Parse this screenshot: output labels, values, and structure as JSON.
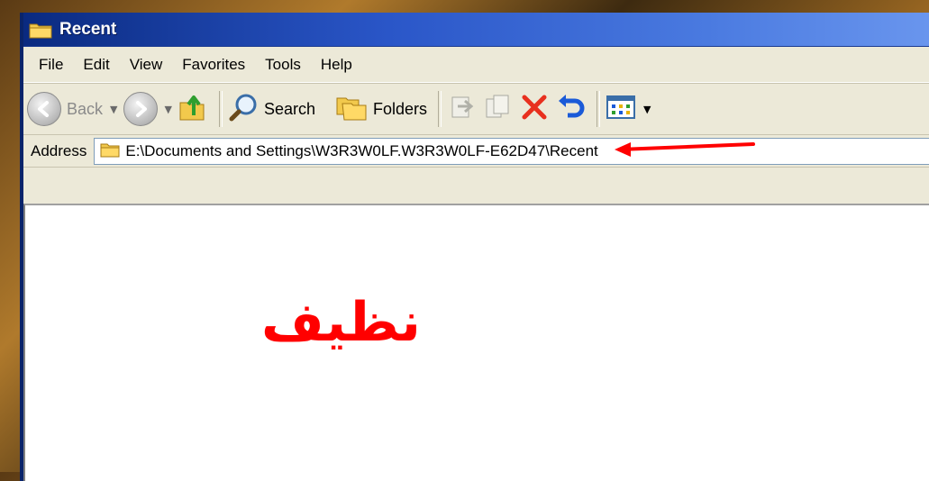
{
  "window": {
    "title": "Recent"
  },
  "menu": {
    "items": [
      "File",
      "Edit",
      "View",
      "Favorites",
      "Tools",
      "Help"
    ]
  },
  "toolbar": {
    "back_label": "Back",
    "search_label": "Search",
    "folders_label": "Folders"
  },
  "address": {
    "label": "Address",
    "value": "E:\\Documents and Settings\\W3R3W0LF.W3R3W0LF-E62D47\\Recent"
  },
  "content": {
    "annotation_text": "نظيف"
  },
  "colors": {
    "title_bar": "#2a56c8",
    "annotation": "#ff0000",
    "arrow": "#ff0000"
  },
  "icons": [
    "folder-icon",
    "back-icon",
    "forward-icon",
    "up-icon",
    "search-icon",
    "folders-icon",
    "move-to-icon",
    "copy-to-icon",
    "delete-icon",
    "undo-icon",
    "views-icon"
  ]
}
